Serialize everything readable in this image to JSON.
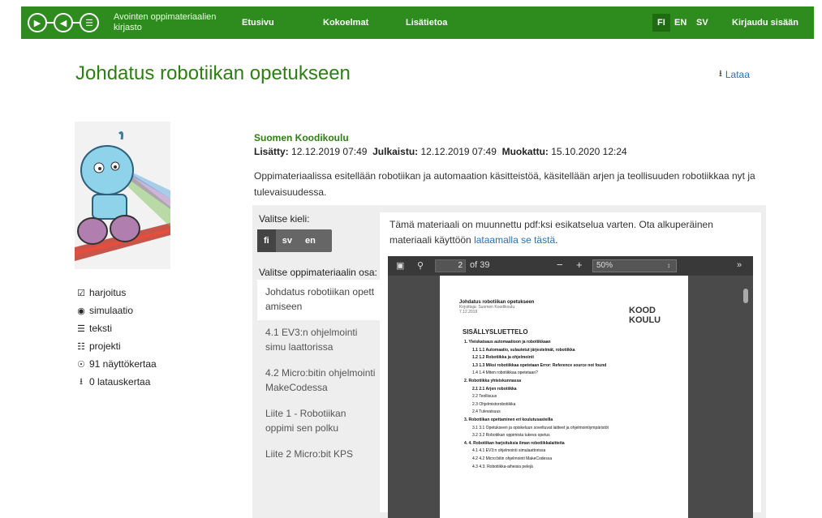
{
  "header": {
    "brand": "Avointen oppimateriaalien kirjasto",
    "nav": [
      "Etusivu",
      "Kokoelmat",
      "Lisätietoa"
    ],
    "languages": [
      {
        "code": "FI",
        "active": true
      },
      {
        "code": "EN",
        "active": false
      },
      {
        "code": "SV",
        "active": false
      }
    ],
    "login": "Kirjaudu sisään"
  },
  "page": {
    "title": "Johdatus robotiikan opetukseen",
    "download": "Lataa",
    "organization": "Suomen Koodikoulu",
    "meta": {
      "added_label": "Lisätty:",
      "added": "12.12.2019 07:49",
      "published_label": "Julkaistu:",
      "published": "12.12.2019 07:49",
      "modified_label": "Muokattu:",
      "modified": "15.10.2020 12:24"
    },
    "description": "Oppimateriaalissa esitellään robotiikan ja automaation käsitteistöä, käsitellään arjen ja teollisuuden robotiikkaa nyt ja tulevaisuudessa."
  },
  "sidebar": {
    "items": [
      {
        "icon": "clipboard-check-icon",
        "label": "harjoitus"
      },
      {
        "icon": "gamepad-icon",
        "label": "simulaatio"
      },
      {
        "icon": "text-lines-icon",
        "label": "teksti"
      },
      {
        "icon": "sitemap-icon",
        "label": "projekti"
      },
      {
        "icon": "eye-icon",
        "label": "91 näyttökertaa"
      },
      {
        "icon": "download-icon",
        "label": "0 latauskertaa"
      }
    ]
  },
  "panel": {
    "language_label": "Valitse kieli:",
    "language_options": [
      {
        "label": "fi",
        "active": true
      },
      {
        "label": "sv",
        "active": false
      },
      {
        "label": "en",
        "active": false
      }
    ],
    "part_label": "Valitse oppimateriaalin osa:",
    "parts": [
      {
        "label": "Johdatus robotiikan opetusamiseen",
        "active": true,
        "display": "Johdatus robotiikan opett amiseen"
      },
      {
        "label": "4.1 EV3:n ohjelmointi simulaattorissa",
        "active": false,
        "display": "4.1 EV3:n ohjelmointi simu laattorissa"
      },
      {
        "label": "4.2 Micro:bitin ohjelmointi MakeCodessa",
        "active": false,
        "display": "4.2 Micro:bitin ohjelmointi MakeCodessa"
      },
      {
        "label": "Liite 1 - Robotiikan oppimisen polku",
        "active": false,
        "display": "Liite 1 - Robotiikan oppimi sen polku"
      },
      {
        "label": "Liite 2 Micro:bit KPS",
        "active": false,
        "display": "Liite 2 Micro:bit KPS"
      }
    ],
    "notice_text": "Tämä materiaali on muunnettu pdf:ksi esikatselua varten. Ota alkuperäinen materiaali käyttöön",
    "notice_link": "lataamalla se tästä",
    "notice_end": "."
  },
  "viewer": {
    "page_current": "2",
    "page_total": "of 39",
    "zoom": "50%",
    "doc_title": "Johdatus robotiikan opetukseen",
    "doc_author": "Kirjoittaja: Suomen Koodikoulu",
    "doc_date": "7.12.2019",
    "logo_text": "KOODI KOULU",
    "toc_heading": "SISÄLLYSLUETTELO",
    "toc": [
      {
        "text": "1. Yleiskatsaus automaatioon ja robotiikkaan",
        "level": 0
      },
      {
        "text": "1.1    1.1 Automaatio, sulautetut järjestelmät, robotiikka",
        "level": 1
      },
      {
        "text": "1.2    1.2 Robotiikka ja ohjelmointi",
        "level": 1
      },
      {
        "text": "1.3    1.3 Miksi robotiikkaa opetetaan Error: Reference source not found",
        "level": 1
      },
      {
        "text": "1.4    1.4 Miten robotiikkaa opetetaan?",
        "level": 1
      },
      {
        "text": "2. Robotiikka yhteiskunnassa",
        "level": 0
      },
      {
        "text": "2.1    2.1 Arjen robotiikka",
        "level": 1
      },
      {
        "text": "2.2    Teollisuus",
        "level": 1
      },
      {
        "text": "2.3    Ohjelmistorobotiikka",
        "level": 1
      },
      {
        "text": "2.4 Tulevaisuus",
        "level": 1
      },
      {
        "text": "3. Robotiikan opettaminen eri koulutusasteilla",
        "level": 0
      },
      {
        "text": "3.1    3.1 Opetukseen ja opiskeluun soveltuvat laitteet ja ohjelmointiympäristöt",
        "level": 1
      },
      {
        "text": "3.2    3.2 Robotiikan oppimista tukeva opetus",
        "level": 1
      },
      {
        "text": "4. 4. Robotiikan harjoituksia ilman robotiikkalaitteita",
        "level": 0
      },
      {
        "text": "4.1    4.1 EV3:n ohjelmointi simulaattorissa",
        "level": 1
      },
      {
        "text": "4.2    4.2 Micro:bitin ohjelmointi MakeCodessa",
        "level": 1
      },
      {
        "text": "4.3    4.3. Robotiikka-aiheisia pelejä",
        "level": 1
      }
    ]
  },
  "colors": {
    "header_green": "#2e8b1e",
    "title_green": "#2e7d15",
    "link_blue": "#2a6fb0"
  }
}
